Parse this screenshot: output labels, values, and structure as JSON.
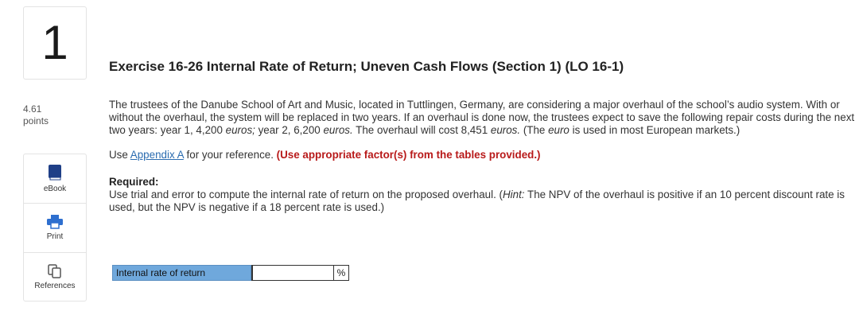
{
  "question": {
    "number": "1",
    "points_value": "4.61",
    "points_label": "points"
  },
  "tools": [
    {
      "label": "eBook",
      "icon": "book-icon"
    },
    {
      "label": "Print",
      "icon": "printer-icon"
    },
    {
      "label": "References",
      "icon": "copy-icon"
    }
  ],
  "exercise": {
    "title": "Exercise 16-26 Internal Rate of Return; Uneven Cash Flows (Section 1) (LO 16-1)",
    "para1": {
      "t1": "The trustees of the Danube School of Art and Music, located in Tuttlingen, Germany, are considering a major overhaul of the school’s audio system. With or without the overhaul, the system will be replaced in two years. If an overhaul is done now, the trustees expect to save the following repair costs during the next two years: year 1, 4,200 ",
      "e1": "euros;",
      "t2": " year 2, 6,200 ",
      "e2": "euros.",
      "t3": " The overhaul will cost 8,451 ",
      "e3": "euros.",
      "t4": " (The ",
      "e4": "euro",
      "t5": " is used in most European markets.)"
    },
    "para2": {
      "pre": "Use ",
      "link": "Appendix A",
      "mid": " for your reference. ",
      "emphasis": "(Use appropriate factor(s) from the tables provided.)"
    },
    "required": {
      "heading": "Required:",
      "t1": "Use trial and error to compute the internal rate of return on the proposed overhaul. (",
      "hint": "Hint:",
      "t2": " The NPV of the overhaul is positive if an 10 percent discount rate is used, but the NPV is negative if a 18 percent rate is used.)"
    }
  },
  "answer": {
    "label": "Internal rate of return",
    "value": "",
    "unit": "%"
  },
  "colors": {
    "answer_label_bg": "#6fa8dc",
    "emphasis_red": "#b81a1a",
    "link_blue": "#2b6cb0",
    "ebook_icon": "#1f3f87",
    "print_icon": "#2e6fcf"
  }
}
